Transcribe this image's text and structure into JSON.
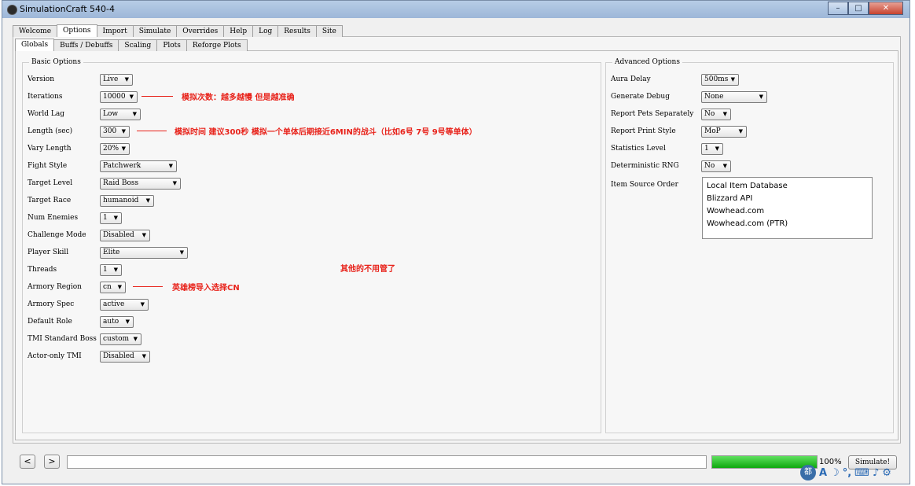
{
  "window": {
    "title": "SimulationCraft 540-4"
  },
  "main_tabs": [
    "Welcome",
    "Options",
    "Import",
    "Simulate",
    "Overrides",
    "Help",
    "Log",
    "Results",
    "Site"
  ],
  "sub_tabs": [
    "Globals",
    "Buffs / Debuffs",
    "Scaling",
    "Plots",
    "Reforge Plots"
  ],
  "basic_options": {
    "title": "Basic Options",
    "rows": [
      {
        "label": "Version",
        "value": "Live"
      },
      {
        "label": "Iterations",
        "value": "10000"
      },
      {
        "label": "World Lag",
        "value": "Low"
      },
      {
        "label": "Length (sec)",
        "value": "300"
      },
      {
        "label": "Vary Length",
        "value": "20%"
      },
      {
        "label": "Fight Style",
        "value": "Patchwerk"
      },
      {
        "label": "Target Level",
        "value": "Raid Boss"
      },
      {
        "label": "Target Race",
        "value": "humanoid"
      },
      {
        "label": "Num Enemies",
        "value": "1"
      },
      {
        "label": "Challenge Mode",
        "value": "Disabled"
      },
      {
        "label": "Player Skill",
        "value": "Elite"
      },
      {
        "label": "Threads",
        "value": "1"
      },
      {
        "label": "Armory Region",
        "value": "cn"
      },
      {
        "label": "Armory Spec",
        "value": "active"
      },
      {
        "label": "Default Role",
        "value": "auto"
      },
      {
        "label": "TMI Standard Boss",
        "value": "custom"
      },
      {
        "label": "Actor-only TMI",
        "value": "Disabled"
      }
    ]
  },
  "advanced_options": {
    "title": "Advanced Options",
    "rows": [
      {
        "label": "Aura Delay",
        "value": "500ms"
      },
      {
        "label": "Generate Debug",
        "value": "None"
      },
      {
        "label": "Report Pets Separately",
        "value": "No"
      },
      {
        "label": "Report Print Style",
        "value": "MoP"
      },
      {
        "label": "Statistics Level",
        "value": "1"
      },
      {
        "label": "Deterministic RNG",
        "value": "No"
      }
    ],
    "item_source_label": "Item Source Order",
    "item_sources": [
      "Local Item Database",
      "Blizzard API",
      "Wowhead.com",
      "Wowhead.com (PTR)"
    ]
  },
  "annotations": {
    "iterations": "模拟次数：越多越慢 但是越准确",
    "length": "模拟时间 建议300秒  模拟一个单体后期接近6MIN的战斗（比如6号 7号 9号等单体）",
    "others": "其他的不用管了",
    "region": "英雄榜导入选择CN"
  },
  "bottom": {
    "back": "<",
    "forward": ">",
    "progress_percent": "100%",
    "progress_fraction": 1.0,
    "simulate_button": "Simulate!"
  },
  "ime": {
    "logo": "都"
  },
  "colors": {
    "annotation": "#e8231b",
    "progress": "#12b012"
  }
}
